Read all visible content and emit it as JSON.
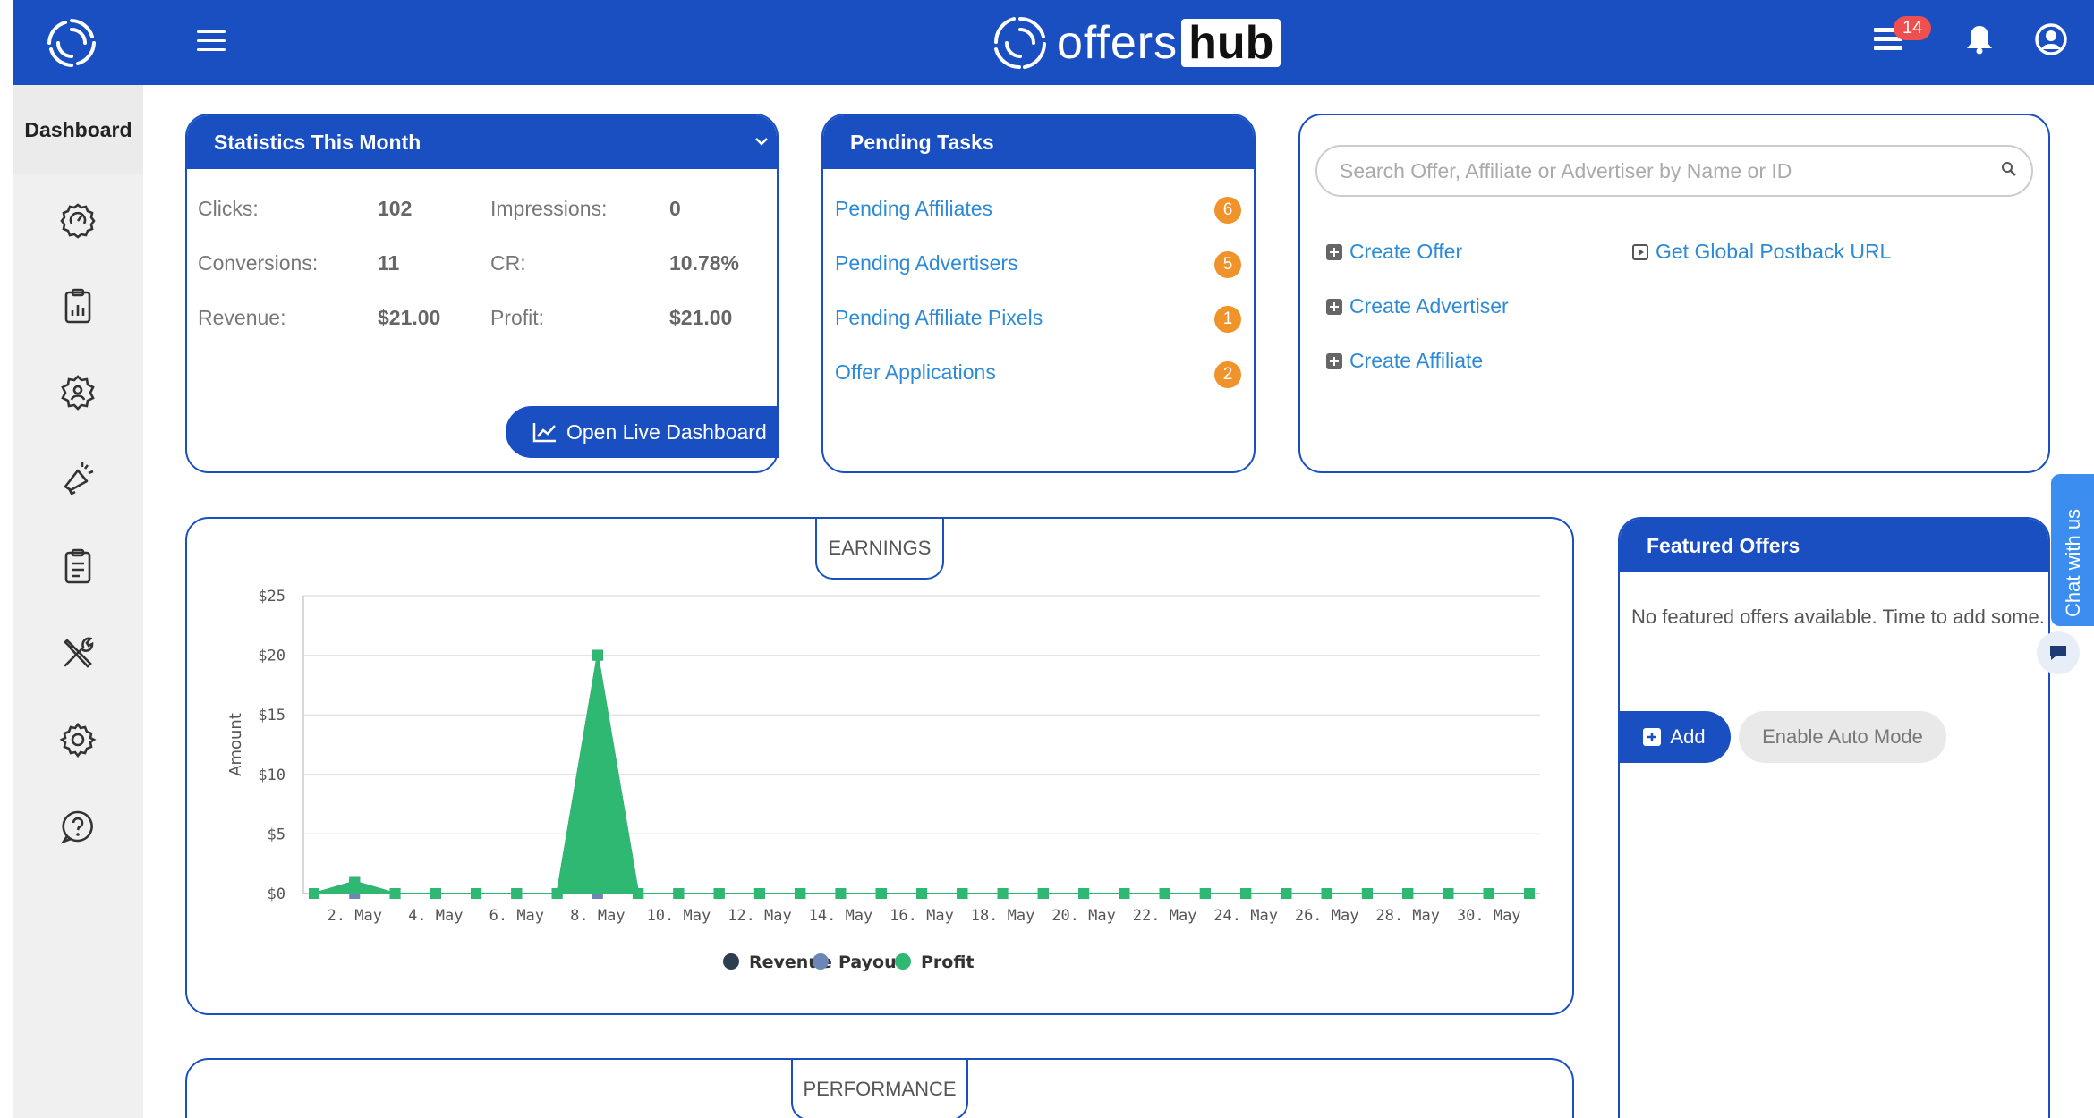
{
  "header": {
    "brand_part1": "offers",
    "brand_part2": "hub",
    "notification_count": "14",
    "accent_color": "#1a4fc2"
  },
  "sidebar": {
    "dashboard_label": "Dashboard",
    "icons": [
      "performance-icon",
      "reports-icon",
      "affiliates-icon",
      "marketing-icon",
      "offers-icon",
      "tools-icon",
      "settings-icon",
      "help-icon"
    ]
  },
  "stats": {
    "title": "Statistics This Month",
    "clicks_label": "Clicks:",
    "clicks_value": "102",
    "impressions_label": "Impressions:",
    "impressions_value": "0",
    "conversions_label": "Conversions:",
    "conversions_value": "11",
    "cr_label": "CR:",
    "cr_value": "10.78%",
    "revenue_label": "Revenue:",
    "revenue_value": "$21.00",
    "profit_label": "Profit:",
    "profit_value": "$21.00",
    "live_button": "Open Live Dashboard"
  },
  "tasks": {
    "title": "Pending Tasks",
    "items": [
      {
        "label": "Pending Affiliates",
        "count": "6"
      },
      {
        "label": "Pending Advertisers",
        "count": "5"
      },
      {
        "label": "Pending Affiliate Pixels",
        "count": "1"
      },
      {
        "label": "Offer Applications",
        "count": "2"
      }
    ]
  },
  "quick": {
    "search_placeholder": "Search Offer, Affiliate or Advertiser by Name or ID",
    "create_offer": "Create Offer",
    "create_advertiser": "Create Advertiser",
    "create_affiliate": "Create Affiliate",
    "postback": "Get Global Postback URL"
  },
  "earnings": {
    "tab_label": "EARNINGS"
  },
  "performance": {
    "tab_label": "PERFORMANCE"
  },
  "featured": {
    "title": "Featured Offers",
    "empty_text": "No featured offers available. Time to add some.",
    "add_button": "Add",
    "auto_button": "Enable Auto Mode"
  },
  "chat": {
    "label": "Chat with us"
  },
  "chart_data": {
    "type": "area",
    "ylabel": "Amount",
    "ylim": [
      0,
      25
    ],
    "yticks": [
      "$0",
      "$5",
      "$10",
      "$15",
      "$20",
      "$25"
    ],
    "x": [
      "1. May",
      "2. May",
      "3. May",
      "4. May",
      "5. May",
      "6. May",
      "7. May",
      "8. May",
      "9. May",
      "10. May",
      "11. May",
      "12. May",
      "13. May",
      "14. May",
      "15. May",
      "16. May",
      "17. May",
      "18. May",
      "19. May",
      "20. May",
      "21. May",
      "22. May",
      "23. May",
      "24. May",
      "25. May",
      "26. May",
      "27. May",
      "28. May",
      "29. May",
      "30. May",
      "31. May"
    ],
    "xtick_labels": [
      "2. May",
      "4. May",
      "6. May",
      "8. May",
      "10. May",
      "12. May",
      "14. May",
      "16. May",
      "18. May",
      "20. May",
      "22. May",
      "24. May",
      "26. May",
      "28. May",
      "30. May"
    ],
    "series": [
      {
        "name": "Revenue",
        "color": "#2c3e50",
        "values": [
          0,
          1,
          0,
          0,
          0,
          0,
          0,
          20,
          0,
          0,
          0,
          0,
          0,
          0,
          0,
          0,
          0,
          0,
          0,
          0,
          0,
          0,
          0,
          0,
          0,
          0,
          0,
          0,
          0,
          0,
          0
        ]
      },
      {
        "name": "Payout",
        "color": "#6c86b8",
        "values": [
          0,
          0,
          0,
          0,
          0,
          0,
          0,
          0,
          0,
          0,
          0,
          0,
          0,
          0,
          0,
          0,
          0,
          0,
          0,
          0,
          0,
          0,
          0,
          0,
          0,
          0,
          0,
          0,
          0,
          0,
          0
        ]
      },
      {
        "name": "Profit",
        "color": "#2eb872",
        "values": [
          0,
          1,
          0,
          0,
          0,
          0,
          0,
          20,
          0,
          0,
          0,
          0,
          0,
          0,
          0,
          0,
          0,
          0,
          0,
          0,
          0,
          0,
          0,
          0,
          0,
          0,
          0,
          0,
          0,
          0,
          0
        ]
      }
    ],
    "grid": true,
    "legend": "bottom"
  }
}
